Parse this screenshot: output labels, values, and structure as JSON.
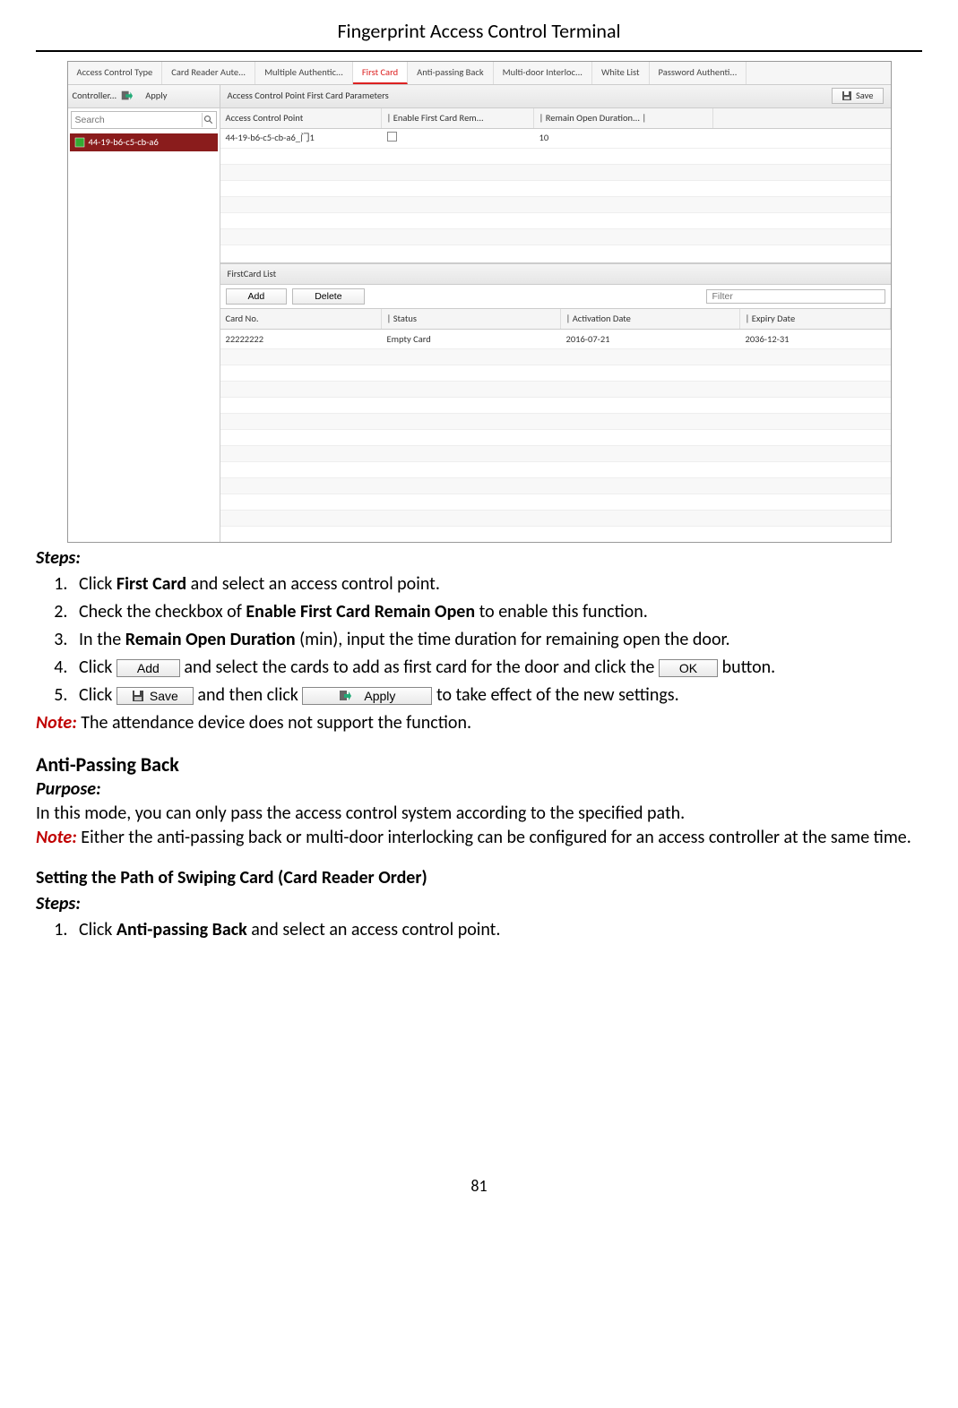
{
  "doc": {
    "title": "Fingerprint Access Control Terminal",
    "page_number": "81"
  },
  "screenshot": {
    "tabs": [
      "Access Control Type",
      "Card Reader Aute...",
      "Multiple Authentic...",
      "First Card",
      "Anti-passing Back",
      "Multi-door Interloc...",
      "White List",
      "Password Authenti..."
    ],
    "active_tab_index": 3,
    "left": {
      "controller_label": "Controller...",
      "apply_label": "Apply",
      "search_placeholder": "Search",
      "tree_item": "44-19-b6-c5-cb-a6"
    },
    "params": {
      "panel_title": "Access Control Point First Card Parameters",
      "save_label": "Save",
      "headers": [
        "Access Control Point",
        "Enable First Card Rem...",
        "Remain Open Duration..."
      ],
      "row": {
        "point": "44-19-b6-c5-cb-a6_门1",
        "enable_checked": false,
        "duration": "10"
      }
    },
    "firstcard_list": {
      "title": "FirstCard List",
      "add_label": "Add",
      "delete_label": "Delete",
      "filter_placeholder": "Filter",
      "headers": [
        "Card No.",
        "Status",
        "Activation Date",
        "Expiry Date"
      ],
      "row": {
        "card_no": "22222222",
        "status": "Empty Card",
        "activation": "2016-07-21",
        "expiry": "2036-12-31"
      }
    }
  },
  "steps1": {
    "heading": "Steps:",
    "items": [
      {
        "pre": "Click ",
        "b": "First Card",
        "post": " and select an access control point."
      },
      {
        "pre": "Check the checkbox of ",
        "b": "Enable First Card Remain Open",
        "post": " to enable this function."
      },
      {
        "pre": "In the ",
        "b": "Remain Open Duration",
        "post": " (min), input the time duration for remaining open the door."
      }
    ],
    "step4_pre": "Click ",
    "step4_mid": " and select the cards to add as first card for the door and click the ",
    "step4_post": " button.",
    "step5_pre": "Click ",
    "step5_mid": " and then click ",
    "step5_post": " to take effect of the new settings.",
    "add_btn": "Add",
    "ok_btn": "OK",
    "save_btn": "Save",
    "apply_btn": "Apply"
  },
  "note1": {
    "label": "Note:",
    "text": " The attendance device does not support the function."
  },
  "section2": {
    "title": "Anti-Passing Back",
    "purpose_label": "Purpose:",
    "purpose_text": "In this mode, you can only pass the access control system according to the specified path.",
    "note_label": "Note:",
    "note_text": " Either the anti-passing back or multi-door interlocking can be configured for an access controller at the same time.",
    "sub_heading": "Setting the Path of Swiping Card (Card Reader Order)",
    "steps_heading": "Steps:",
    "step1_pre": "Click ",
    "step1_b": "Anti-passing Back",
    "step1_post": " and select an access control point."
  }
}
